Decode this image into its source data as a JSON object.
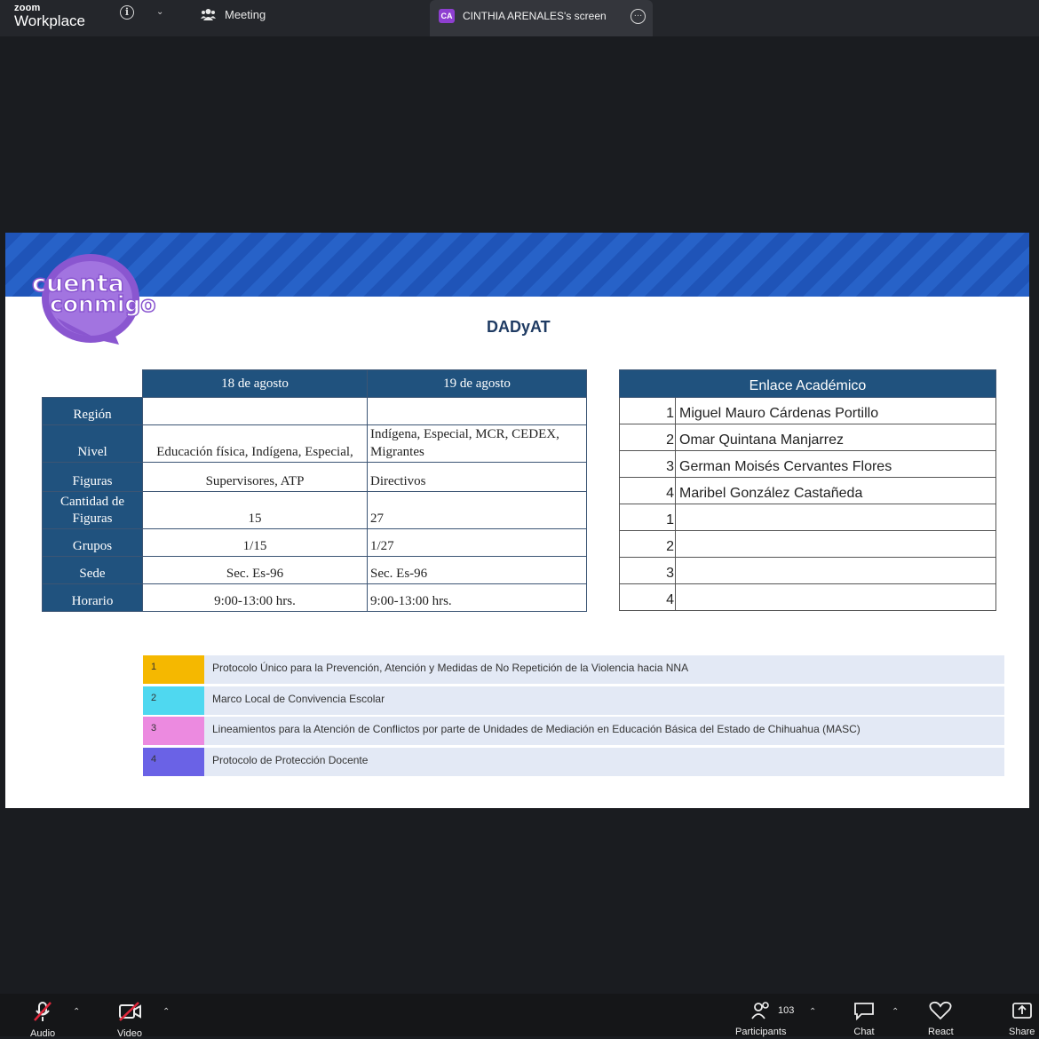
{
  "topbar": {
    "logo_small": "zoom",
    "logo_big": "Workplace",
    "meeting_label": "Meeting",
    "screen_badge": "CA",
    "screen_label": "CINTHIA ARENALES's screen",
    "more_glyph": "…"
  },
  "slide": {
    "logo_line1": "cuenta",
    "logo_line2": "conmigo",
    "title": "DADyAT",
    "schedule": {
      "headers": [
        "18 de agosto",
        "19 de agosto"
      ],
      "rows": [
        {
          "label": "Región",
          "c1": "",
          "c2": ""
        },
        {
          "label": "Nivel",
          "c1": "Educación física, Indígena, Especial,",
          "c2": "Indígena, Especial, MCR, CEDEX, Migrantes"
        },
        {
          "label": "Figuras",
          "c1": "Supervisores, ATP",
          "c2": "Directivos"
        },
        {
          "label": "Cantidad de Figuras",
          "c1": "15",
          "c2": "27"
        },
        {
          "label": "Grupos",
          "c1": "1/15",
          "c2": "1/27"
        },
        {
          "label": "Sede",
          "c1": "Sec. Es-96",
          "c2": "Sec. Es-96"
        },
        {
          "label": "Horario",
          "c1": "9:00-13:00 hrs.",
          "c2": "9:00-13:00 hrs."
        }
      ]
    },
    "enlace": {
      "header": "Enlace Académico",
      "rows": [
        {
          "num": "1",
          "name": "Miguel Mauro Cárdenas Portillo"
        },
        {
          "num": "2",
          "name": "Omar Quintana Manjarrez"
        },
        {
          "num": "3",
          "name": "German Moisés Cervantes Flores"
        },
        {
          "num": "4",
          "name": "Maribel González Castañeda"
        },
        {
          "num": "1",
          "name": ""
        },
        {
          "num": "2",
          "name": ""
        },
        {
          "num": "3",
          "name": ""
        },
        {
          "num": "4",
          "name": ""
        }
      ]
    },
    "documents": [
      {
        "num": "1",
        "text": "Protocolo Único para la Prevención, Atención y Medidas de No Repetición de la Violencia hacia NNA",
        "color": "#f5b800"
      },
      {
        "num": "2",
        "text": "Marco Local de Convivencia Escolar",
        "color": "#4fd8f0"
      },
      {
        "num": "3",
        "text": "Lineamientos para la Atención de Conflictos por parte de Unidades de Mediación en Educación Básica del Estado de Chihuahua (MASC)",
        "color": "#ec8ae0"
      },
      {
        "num": "4",
        "text": "Protocolo de Protección Docente",
        "color": "#6a62e6"
      }
    ]
  },
  "bottombar": {
    "audio": "Audio",
    "video": "Video",
    "participants": "Participants",
    "participants_count": "103",
    "chat": "Chat",
    "react": "React",
    "share": "Share"
  },
  "colors": {
    "header_blue": "#20527e",
    "banner_blue": "#2762c8",
    "logo_purple": "#8a56d0"
  }
}
